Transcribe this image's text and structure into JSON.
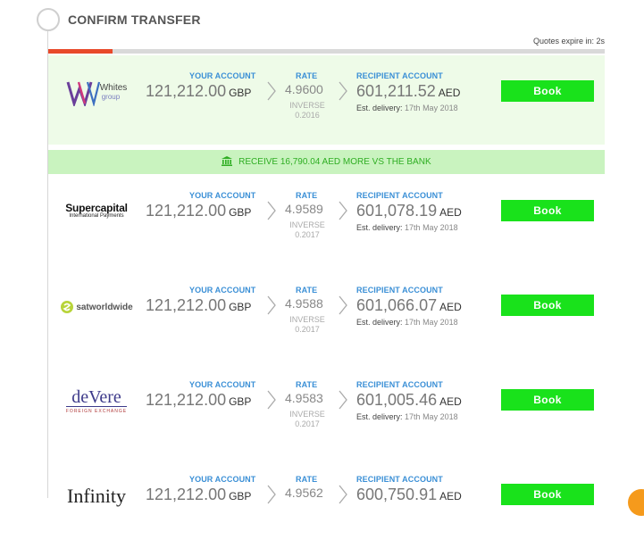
{
  "header": {
    "title": "CONFIRM TRANSFER",
    "expire_text": "Quotes expire in: 2s",
    "progress_fraction": 0.115
  },
  "labels": {
    "your_account": "YOUR ACCOUNT",
    "rate": "RATE",
    "recipient_account": "RECIPIENT ACCOUNT",
    "inverse": "INVERSE",
    "est_delivery": "Est. delivery:",
    "book": "Book"
  },
  "banner": {
    "text": "RECEIVE 16,790.04 AED MORE VS THE BANK"
  },
  "quotes": [
    {
      "provider": "Whites group",
      "logo_main": "Whites",
      "logo_sub": "group",
      "send_amount": "121,212.00",
      "send_currency": "GBP",
      "rate": "4.9600",
      "inverse": "0.2016",
      "receive_amount": "601,211.52",
      "receive_currency": "AED",
      "delivery": "17th May 2018"
    },
    {
      "provider": "Supercapital",
      "logo_main": "Supercapital",
      "logo_sub": "International Payments",
      "send_amount": "121,212.00",
      "send_currency": "GBP",
      "rate": "4.9589",
      "inverse": "0.2017",
      "receive_amount": "601,078.19",
      "receive_currency": "AED",
      "delivery": "17th May 2018"
    },
    {
      "provider": "satworldwide",
      "logo_main": "satworldwide",
      "logo_sub": "",
      "send_amount": "121,212.00",
      "send_currency": "GBP",
      "rate": "4.9588",
      "inverse": "0.2017",
      "receive_amount": "601,066.07",
      "receive_currency": "AED",
      "delivery": "17th May 2018"
    },
    {
      "provider": "deVere",
      "logo_main": "deVere",
      "logo_sub": "FOREIGN EXCHANGE",
      "send_amount": "121,212.00",
      "send_currency": "GBP",
      "rate": "4.9583",
      "inverse": "0.2017",
      "receive_amount": "601,005.46",
      "receive_currency": "AED",
      "delivery": "17th May 2018"
    },
    {
      "provider": "Infinity",
      "logo_main": "Infinity",
      "logo_sub": "",
      "send_amount": "121,212.00",
      "send_currency": "GBP",
      "rate": "4.9562",
      "inverse": "",
      "receive_amount": "600,750.91",
      "receive_currency": "AED",
      "delivery": ""
    }
  ],
  "colors": {
    "accent_blue": "#3a8fd6",
    "book_green": "#19e21b",
    "progress_red": "#e8492a",
    "best_bg": "#eefbe8",
    "banner_bg": "#c9f3bf"
  }
}
